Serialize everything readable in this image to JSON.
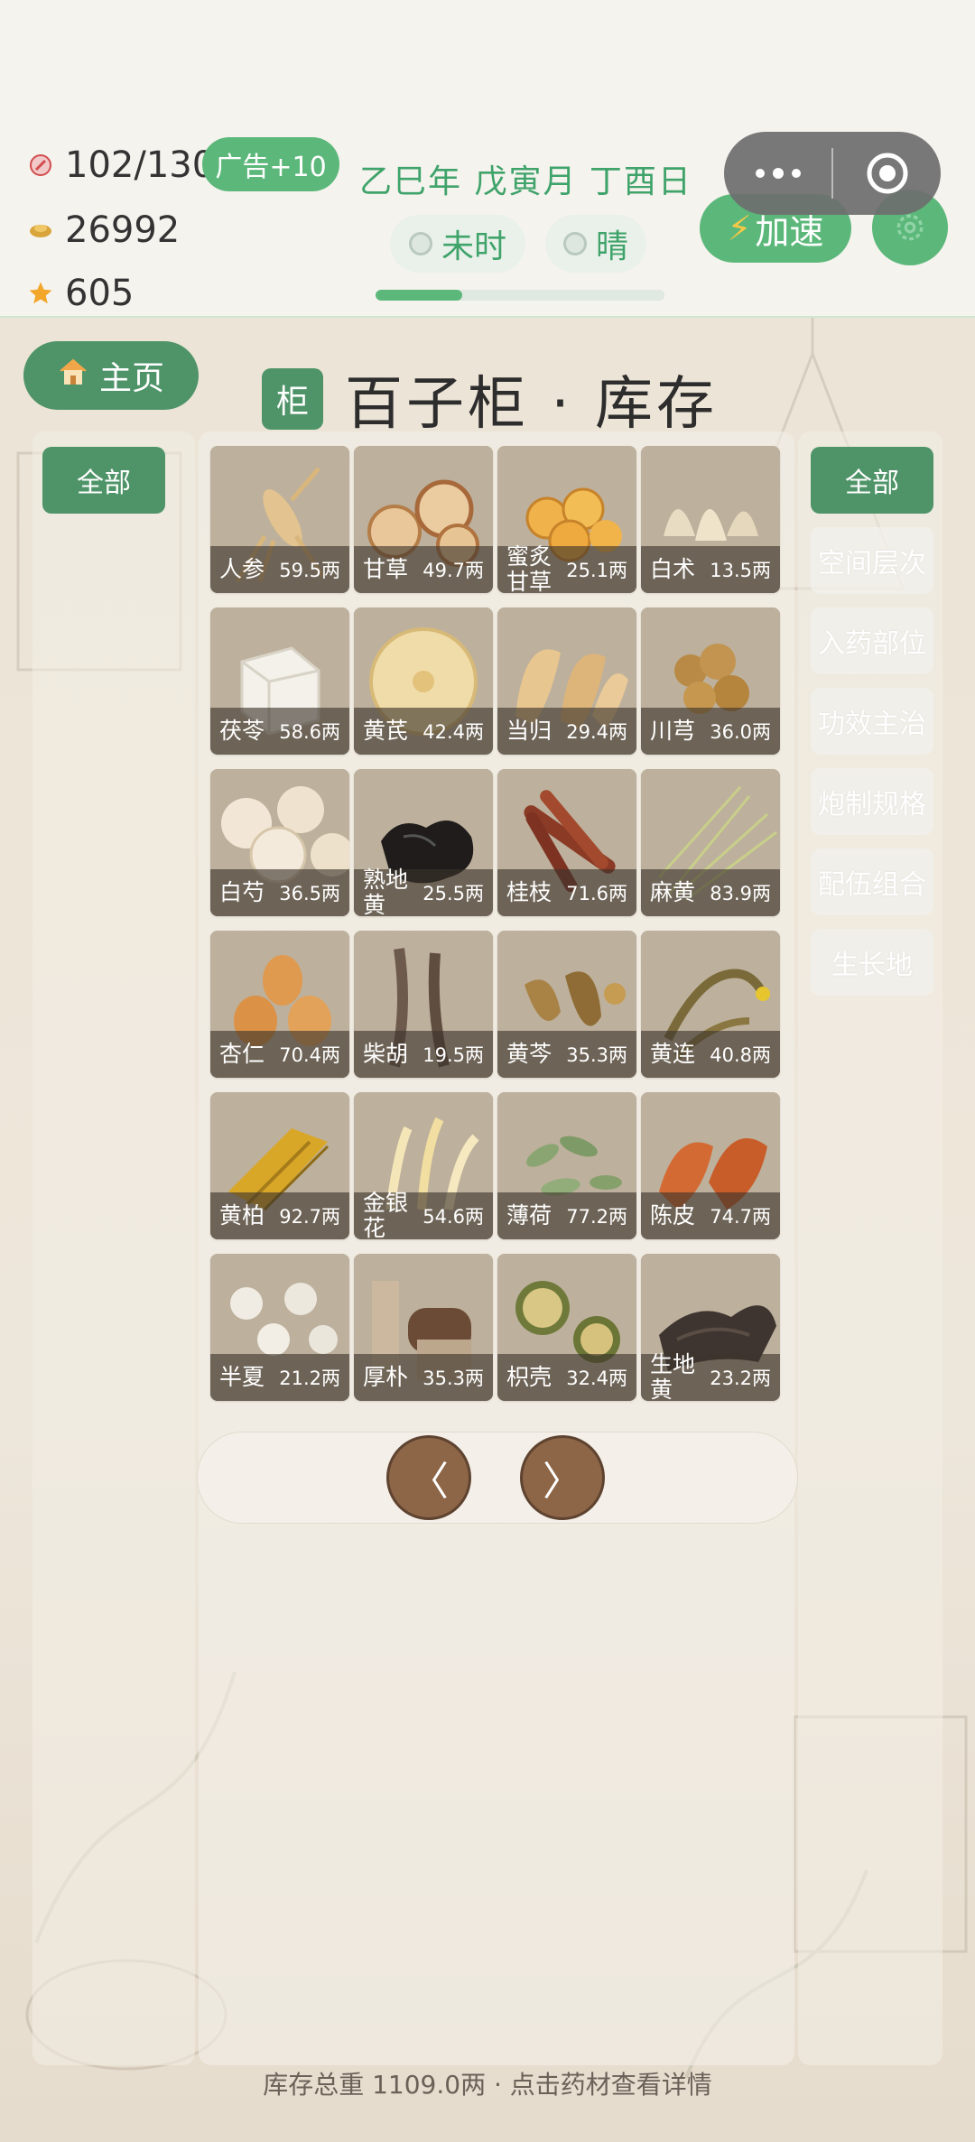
{
  "status": {
    "energy": "102/130",
    "coins": "26992",
    "stars": "605",
    "ad_button": "广告+10",
    "date": "乙巳年 戊寅月 丁酉日",
    "time_chip": "未时",
    "weather_chip": "晴",
    "day_progress": 0.3,
    "speed_button": "加速"
  },
  "nav": {
    "home_button": "主页"
  },
  "title": {
    "badge": "柜",
    "text": "百子柜 · 库存"
  },
  "left_filter": "全部",
  "right_filters": [
    "全部",
    "空间层次",
    "入药部位",
    "功效主治",
    "炮制规格",
    "配伍组合",
    "生长地"
  ],
  "items": [
    {
      "name": "人参",
      "amount": "59.5两",
      "icon": "ginseng-icon"
    },
    {
      "name": "甘草",
      "amount": "49.7两",
      "icon": "licorice-slices-icon"
    },
    {
      "name": "蜜炙甘草",
      "amount": "25.1两",
      "icon": "honey-licorice-icon"
    },
    {
      "name": "白术",
      "amount": "13.5两",
      "icon": "atractylodes-icon"
    },
    {
      "name": "茯苓",
      "amount": "58.6两",
      "icon": "poria-cube-icon"
    },
    {
      "name": "黄芪",
      "amount": "42.4两",
      "icon": "astragalus-slice-icon"
    },
    {
      "name": "当归",
      "amount": "29.4两",
      "icon": "angelica-slices-icon"
    },
    {
      "name": "川芎",
      "amount": "36.0两",
      "icon": "ligusticum-icon"
    },
    {
      "name": "白芍",
      "amount": "36.5两",
      "icon": "peony-slices-icon"
    },
    {
      "name": "熟地黄",
      "amount": "25.5两",
      "icon": "rehmannia-prepared-icon"
    },
    {
      "name": "桂枝",
      "amount": "71.6两",
      "icon": "cinnamon-twig-icon"
    },
    {
      "name": "麻黄",
      "amount": "83.9两",
      "icon": "ephedra-icon"
    },
    {
      "name": "杏仁",
      "amount": "70.4两",
      "icon": "apricot-kernel-icon"
    },
    {
      "name": "柴胡",
      "amount": "19.5两",
      "icon": "bupleurum-root-icon"
    },
    {
      "name": "黄芩",
      "amount": "35.3两",
      "icon": "scutellaria-icon"
    },
    {
      "name": "黄连",
      "amount": "40.8两",
      "icon": "coptis-icon"
    },
    {
      "name": "黄柏",
      "amount": "92.7两",
      "icon": "phellodendron-bark-icon"
    },
    {
      "name": "金银花",
      "amount": "54.6两",
      "icon": "honeysuckle-icon"
    },
    {
      "name": "薄荷",
      "amount": "77.2两",
      "icon": "mint-leaves-icon"
    },
    {
      "name": "陈皮",
      "amount": "74.7两",
      "icon": "tangerine-peel-icon"
    },
    {
      "name": "半夏",
      "amount": "21.2两",
      "icon": "pinellia-icon"
    },
    {
      "name": "厚朴",
      "amount": "35.3两",
      "icon": "magnolia-bark-icon"
    },
    {
      "name": "枳壳",
      "amount": "32.4两",
      "icon": "bitter-orange-icon"
    },
    {
      "name": "生地黄",
      "amount": "23.2两",
      "icon": "rehmannia-raw-icon"
    }
  ],
  "pager": {
    "prev": "〈",
    "next": "〉"
  },
  "footer": "库存总重 1109.0两 · 点击药材查看详情"
}
